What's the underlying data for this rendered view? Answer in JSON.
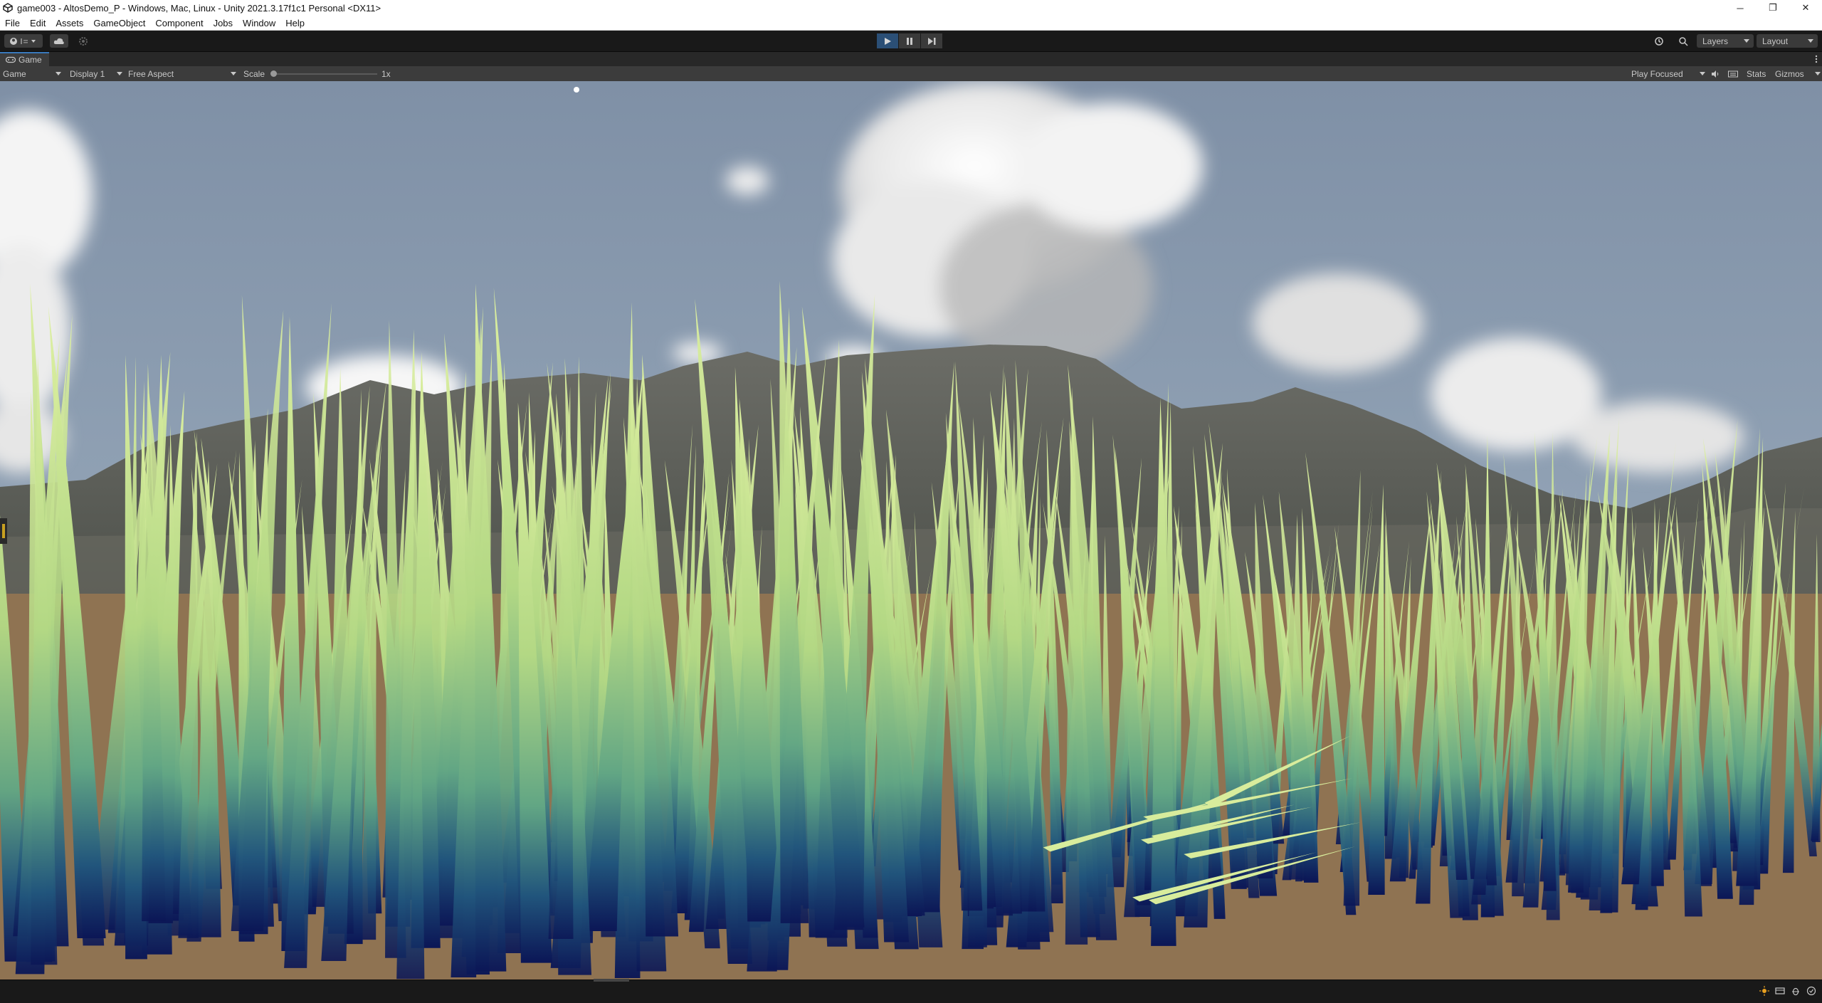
{
  "window": {
    "title": "game003 - AltosDemo_P - Windows, Mac, Linux - Unity 2021.3.17f1c1 Personal <DX11>",
    "controls": {
      "minimize": "─",
      "restore": "❐",
      "close": "✕"
    }
  },
  "menu": [
    "File",
    "Edit",
    "Assets",
    "GameObject",
    "Component",
    "Jobs",
    "Window",
    "Help"
  ],
  "toolbar": {
    "account_icon": "account-icon",
    "cloud_icon": "cloud-icon",
    "settings_icon": "gear-icon",
    "play_state": "playing",
    "layers_label": "Layers",
    "layout_label": "Layout"
  },
  "tabs": [
    {
      "label": "Game",
      "icon": "gamepad-icon"
    }
  ],
  "game_toolbar": {
    "view_label": "Game",
    "display_label": "Display 1",
    "aspect_label": "Free Aspect",
    "scale_label": "Scale",
    "scale_value": "1x",
    "play_mode_label": "Play Focused",
    "stats_label": "Stats",
    "gizmos_label": "Gizmos"
  },
  "scene": {
    "sky_color": "#8798ad",
    "ground_color": "#8f7352",
    "grass_top_color": "#d6ec9a",
    "grass_bottom_color": "#0d1a5a",
    "mountain_color": "#5b5d55"
  },
  "accent": "#2b4f76"
}
